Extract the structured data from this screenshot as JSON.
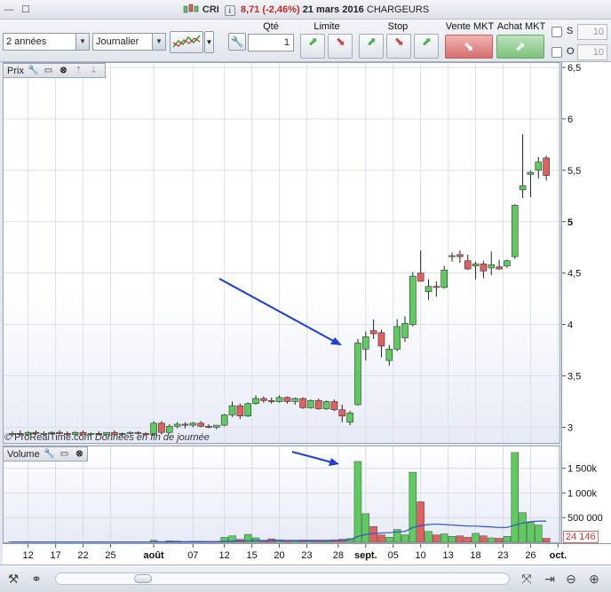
{
  "window": {
    "ticker": "CRI",
    "price": "8,71 (-2,46%)",
    "date": "21 mars 2016",
    "name": "CHARGEURS"
  },
  "toolbar": {
    "period": "2 années",
    "interval": "Journalier",
    "qty_label": "Qté",
    "qty_value": "1",
    "limit_label": "Limite",
    "stop_label": "Stop",
    "sell_mkt_label": "Vente MKT",
    "buy_mkt_label": "Achat MKT",
    "s_label": "S",
    "o_label": "O",
    "s_value": "10",
    "o_value": "10"
  },
  "price_pane": {
    "title": "Prix"
  },
  "volume_pane": {
    "title": "Volume",
    "last_volume": "24 146"
  },
  "watermark": {
    "brand": "© ProRealTime.com",
    "note": "Données en fin de journée"
  },
  "colors": {
    "up": "#5ecb5e",
    "down": "#e26060",
    "wick": "#222222",
    "volume_ma": "#2a55c9",
    "arrow": "#1f3fd6"
  },
  "chart_data": [
    {
      "type": "candlestick",
      "title": "Prix",
      "yticks": [
        "3",
        "3,5",
        "4",
        "4,5",
        "5",
        "5,5",
        "6",
        "6,5"
      ],
      "ylim": [
        2.9,
        6.5
      ],
      "x_tick_labels": [
        "12",
        "17",
        "22",
        "25",
        "août",
        "07",
        "12",
        "15",
        "20",
        "23",
        "28",
        "sept.",
        "05",
        "10",
        "13",
        "18",
        "23",
        "26",
        "oct."
      ],
      "grid": true,
      "candles": [
        {
          "o": 2.93,
          "h": 2.96,
          "l": 2.91,
          "c": 2.94
        },
        {
          "o": 2.94,
          "h": 2.97,
          "l": 2.92,
          "c": 2.93
        },
        {
          "o": 2.93,
          "h": 2.96,
          "l": 2.92,
          "c": 2.95
        },
        {
          "o": 2.95,
          "h": 2.97,
          "l": 2.93,
          "c": 2.94
        },
        {
          "o": 2.94,
          "h": 2.96,
          "l": 2.92,
          "c": 2.94
        },
        {
          "o": 2.94,
          "h": 2.96,
          "l": 2.93,
          "c": 2.95
        },
        {
          "o": 2.95,
          "h": 2.97,
          "l": 2.93,
          "c": 2.94
        },
        {
          "o": 2.94,
          "h": 2.96,
          "l": 2.92,
          "c": 2.93
        },
        {
          "o": 2.93,
          "h": 2.96,
          "l": 2.92,
          "c": 2.95
        },
        {
          "o": 2.95,
          "h": 2.97,
          "l": 2.93,
          "c": 2.93
        },
        {
          "o": 2.93,
          "h": 2.95,
          "l": 2.91,
          "c": 2.94
        },
        {
          "o": 2.94,
          "h": 2.96,
          "l": 2.92,
          "c": 2.93
        },
        {
          "o": 2.93,
          "h": 2.95,
          "l": 2.92,
          "c": 2.95
        },
        {
          "o": 2.95,
          "h": 2.97,
          "l": 2.93,
          "c": 2.93
        },
        {
          "o": 2.93,
          "h": 2.95,
          "l": 2.92,
          "c": 2.94
        },
        {
          "o": 2.94,
          "h": 2.96,
          "l": 2.93,
          "c": 2.95
        },
        {
          "o": 2.95,
          "h": 2.96,
          "l": 2.93,
          "c": 2.94
        },
        {
          "o": 2.94,
          "h": 2.95,
          "l": 2.92,
          "c": 2.93
        },
        {
          "o": 2.93,
          "h": 3.06,
          "l": 2.92,
          "c": 3.04
        },
        {
          "o": 3.04,
          "h": 3.06,
          "l": 2.93,
          "c": 2.95
        },
        {
          "o": 2.95,
          "h": 3.03,
          "l": 2.94,
          "c": 3.01
        },
        {
          "o": 3.01,
          "h": 3.05,
          "l": 2.99,
          "c": 3.03
        },
        {
          "o": 3.03,
          "h": 3.05,
          "l": 2.99,
          "c": 3.02
        },
        {
          "o": 3.02,
          "h": 3.05,
          "l": 3.0,
          "c": 3.04
        },
        {
          "o": 3.04,
          "h": 3.06,
          "l": 3.0,
          "c": 3.01
        },
        {
          "o": 3.01,
          "h": 3.03,
          "l": 2.99,
          "c": 3.0
        },
        {
          "o": 3.0,
          "h": 3.02,
          "l": 2.98,
          "c": 3.02
        },
        {
          "o": 3.02,
          "h": 3.13,
          "l": 3.01,
          "c": 3.12
        },
        {
          "o": 3.12,
          "h": 3.25,
          "l": 3.1,
          "c": 3.21
        },
        {
          "o": 3.21,
          "h": 3.23,
          "l": 3.08,
          "c": 3.11
        },
        {
          "o": 3.11,
          "h": 3.24,
          "l": 3.1,
          "c": 3.23
        },
        {
          "o": 3.23,
          "h": 3.31,
          "l": 3.22,
          "c": 3.28
        },
        {
          "o": 3.28,
          "h": 3.3,
          "l": 3.24,
          "c": 3.26
        },
        {
          "o": 3.26,
          "h": 3.29,
          "l": 3.23,
          "c": 3.25
        },
        {
          "o": 3.25,
          "h": 3.31,
          "l": 3.24,
          "c": 3.29
        },
        {
          "o": 3.29,
          "h": 3.3,
          "l": 3.23,
          "c": 3.25
        },
        {
          "o": 3.25,
          "h": 3.29,
          "l": 3.22,
          "c": 3.28
        },
        {
          "o": 3.28,
          "h": 3.29,
          "l": 3.18,
          "c": 3.19
        },
        {
          "o": 3.19,
          "h": 3.27,
          "l": 3.18,
          "c": 3.26
        },
        {
          "o": 3.26,
          "h": 3.28,
          "l": 3.17,
          "c": 3.18
        },
        {
          "o": 3.18,
          "h": 3.26,
          "l": 3.17,
          "c": 3.25
        },
        {
          "o": 3.25,
          "h": 3.27,
          "l": 3.16,
          "c": 3.17
        },
        {
          "o": 3.17,
          "h": 3.22,
          "l": 3.05,
          "c": 3.11
        },
        {
          "o": 3.05,
          "h": 3.16,
          "l": 3.02,
          "c": 3.14
        },
        {
          "o": 3.22,
          "h": 3.86,
          "l": 3.21,
          "c": 3.82
        },
        {
          "o": 3.76,
          "h": 3.93,
          "l": 3.65,
          "c": 3.88
        },
        {
          "o": 3.94,
          "h": 4.05,
          "l": 3.86,
          "c": 3.91
        },
        {
          "o": 3.92,
          "h": 3.95,
          "l": 3.68,
          "c": 3.79
        },
        {
          "o": 3.65,
          "h": 3.8,
          "l": 3.6,
          "c": 3.76
        },
        {
          "o": 3.76,
          "h": 4.05,
          "l": 3.74,
          "c": 3.98
        },
        {
          "o": 3.87,
          "h": 4.08,
          "l": 3.83,
          "c": 4.01
        },
        {
          "o": 4.0,
          "h": 4.51,
          "l": 3.98,
          "c": 4.47
        },
        {
          "o": 4.5,
          "h": 4.72,
          "l": 4.44,
          "c": 4.42
        },
        {
          "o": 4.32,
          "h": 4.44,
          "l": 4.24,
          "c": 4.37
        },
        {
          "o": 4.37,
          "h": 4.42,
          "l": 4.27,
          "c": 4.36
        },
        {
          "o": 4.36,
          "h": 4.57,
          "l": 4.35,
          "c": 4.53
        },
        {
          "o": 4.67,
          "h": 4.7,
          "l": 4.61,
          "c": 4.67
        },
        {
          "o": 4.68,
          "h": 4.72,
          "l": 4.6,
          "c": 4.66
        },
        {
          "o": 4.62,
          "h": 4.68,
          "l": 4.53,
          "c": 4.54
        },
        {
          "o": 4.57,
          "h": 4.61,
          "l": 4.44,
          "c": 4.59
        },
        {
          "o": 4.59,
          "h": 4.62,
          "l": 4.45,
          "c": 4.52
        },
        {
          "o": 4.55,
          "h": 4.71,
          "l": 4.48,
          "c": 4.58
        },
        {
          "o": 4.56,
          "h": 4.63,
          "l": 4.53,
          "c": 4.54
        },
        {
          "o": 4.57,
          "h": 4.63,
          "l": 4.55,
          "c": 4.62
        },
        {
          "o": 4.66,
          "h": 5.17,
          "l": 4.64,
          "c": 5.16
        },
        {
          "o": 5.31,
          "h": 5.85,
          "l": 5.23,
          "c": 5.35
        },
        {
          "o": 5.46,
          "h": 5.5,
          "l": 5.24,
          "c": 5.48
        },
        {
          "o": 5.5,
          "h": 5.63,
          "l": 5.42,
          "c": 5.58
        },
        {
          "o": 5.62,
          "h": 5.64,
          "l": 5.4,
          "c": 5.45
        }
      ]
    },
    {
      "type": "bar",
      "title": "Volume",
      "yticks": [
        "500 000",
        "1 000k",
        "1 500k"
      ],
      "ylim": [
        0,
        1800000
      ],
      "series": [
        {
          "values": [
            8000,
            5000,
            6000,
            4000,
            5000,
            7000,
            6000,
            4000,
            5000,
            6000,
            5000,
            6000,
            4000,
            5000,
            6000,
            7000,
            5000,
            4000,
            40000,
            12000,
            30000,
            25000,
            15000,
            18000,
            20000,
            12000,
            15000,
            100000,
            130000,
            60000,
            160000,
            90000,
            40000,
            70000,
            50000,
            35000,
            30000,
            45000,
            25000,
            30000,
            20000,
            50000,
            60000,
            75000,
            1640000,
            580000,
            320000,
            150000,
            100000,
            260000,
            150000,
            1420000,
            820000,
            220000,
            150000,
            170000,
            120000,
            130000,
            100000,
            180000,
            130000,
            90000,
            80000,
            120000,
            1820000,
            600000,
            400000,
            350000,
            80000
          ]
        },
        {
          "name": "",
          "values": [
            5000,
            5000,
            5000,
            5000,
            5000,
            5000,
            5000,
            5000,
            5000,
            5000,
            5000,
            5000,
            5000,
            5000,
            5000,
            5000,
            5000,
            5000,
            8000,
            9000,
            10000,
            11000,
            12000,
            13000,
            14000,
            14000,
            15000,
            20000,
            25000,
            28000,
            33000,
            36000,
            36000,
            38000,
            38000,
            38000,
            38000,
            38000,
            38000,
            38000,
            38000,
            40000,
            45000,
            50000,
            120000,
            160000,
            180000,
            190000,
            195000,
            210000,
            220000,
            300000,
            340000,
            360000,
            370000,
            360000,
            350000,
            340000,
            330000,
            330000,
            320000,
            310000,
            300000,
            300000,
            350000,
            390000,
            420000,
            430000,
            430000
          ]
        }
      ]
    }
  ]
}
